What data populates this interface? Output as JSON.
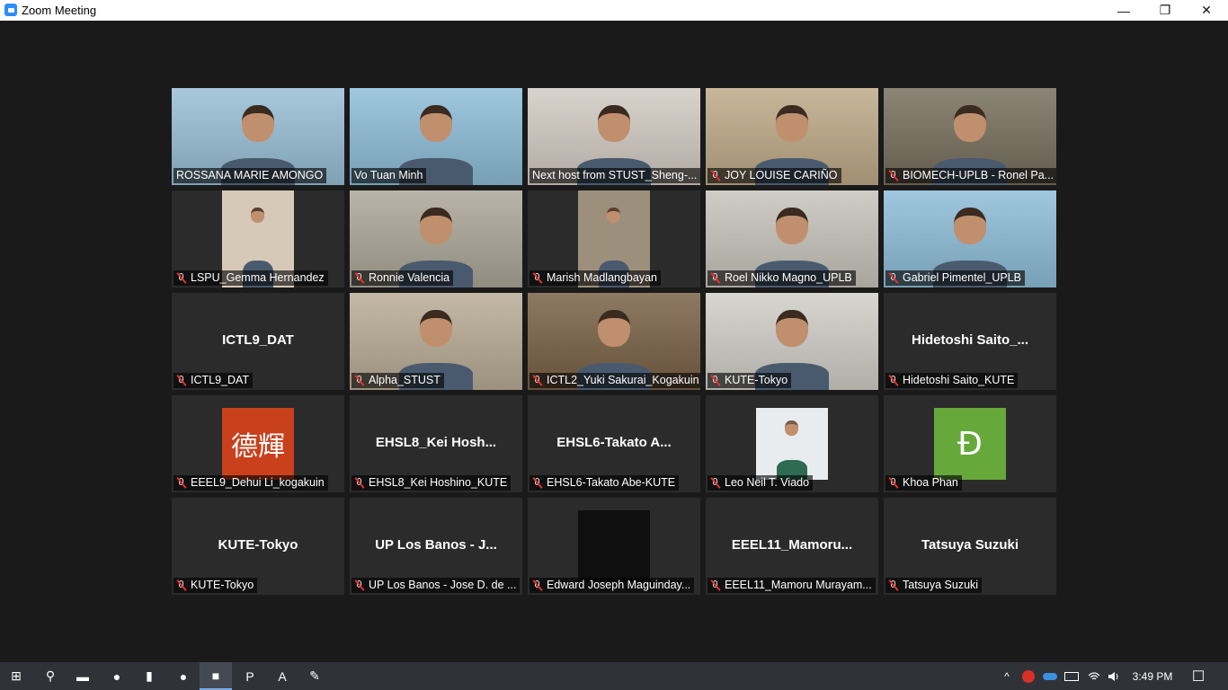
{
  "window": {
    "title": "Zoom Meeting",
    "minimize_glyph": "—",
    "restore_glyph": "❐",
    "close_glyph": "✕"
  },
  "participants": [
    {
      "label": "ROSSANA MARIE AMONGO",
      "video": true,
      "muted": false,
      "bg": "#a8c8dc"
    },
    {
      "label": "Vo Tuan Minh",
      "video": true,
      "muted": false,
      "active_speaker": true,
      "bg": "#9fc7de"
    },
    {
      "label": "Next host from STUST_Sheng-...",
      "video": true,
      "muted": false,
      "bg": "#d9d3cc"
    },
    {
      "label": "JOY LOUISE CARIÑO",
      "video": true,
      "muted": true,
      "bg": "#c9b79a"
    },
    {
      "label": "BIOMECH-UPLB - Ronel Pa...",
      "video": true,
      "muted": true,
      "bg": "#8c8576"
    },
    {
      "label": "LSPU_Gemma Hernandez",
      "video": true,
      "muted": true,
      "bg": "#d7c9b8",
      "inset": true
    },
    {
      "label": "Ronnie Valencia",
      "video": true,
      "muted": true,
      "bg": "#b9b4a8"
    },
    {
      "label": "Marish Madlangbayan",
      "video": true,
      "muted": true,
      "bg": "#9c8f7c",
      "inset": true
    },
    {
      "label": "Roel Nikko Magno_UPLB",
      "video": true,
      "muted": true,
      "bg": "#cfcdc5"
    },
    {
      "label": "Gabriel Pimentel_UPLB",
      "video": true,
      "muted": true,
      "bg": "#9fc7de"
    },
    {
      "label": "ICTL9_DAT",
      "video": false,
      "muted": true,
      "display_name": "ICTL9_DAT"
    },
    {
      "label": "Alpha_STUST",
      "video": true,
      "muted": true,
      "bg": "#c4b9a6"
    },
    {
      "label": "ICTL2_Yuki Sakurai_Kogakuin",
      "video": true,
      "muted": true,
      "bg": "#8e7a62"
    },
    {
      "label": "KUTE-Tokyo",
      "video": true,
      "muted": true,
      "bg": "#d8d6d0"
    },
    {
      "label": "Hidetoshi Saito_KUTE",
      "video": false,
      "muted": true,
      "display_name": "Hidetoshi  Saito_..."
    },
    {
      "label": "EEEL9_Dehui Li_kogakuin",
      "video": false,
      "muted": true,
      "avatar_text": "德輝",
      "avatar_bg": "#c9401c"
    },
    {
      "label": "EHSL8_Kei Hoshino_KUTE",
      "video": false,
      "muted": true,
      "display_name": "EHSL8_Kei  Hosh..."
    },
    {
      "label": "EHSL6-Takato Abe-KUTE",
      "video": false,
      "muted": true,
      "display_name": "EHSL6-Takato  A..."
    },
    {
      "label": "Leo Neil T. Viado",
      "video": false,
      "muted": true,
      "avatar_photo": true,
      "avatar_bg": "#e9ecef"
    },
    {
      "label": "Khoa Phan",
      "video": false,
      "muted": true,
      "avatar_text": "Đ",
      "avatar_bg": "#66a83a"
    },
    {
      "label": "KUTE-Tokyo",
      "video": false,
      "muted": true,
      "display_name": "KUTE-Tokyo"
    },
    {
      "label": "UP Los Banos - Jose D. de ...",
      "video": false,
      "muted": true,
      "display_name": "UP Los Banos - J..."
    },
    {
      "label": "Edward Joseph Maguinday...",
      "video": false,
      "muted": true,
      "avatar_dark": true,
      "avatar_bg": "#0f0f0f"
    },
    {
      "label": "EEEL11_Mamoru Murayam...",
      "video": false,
      "muted": true,
      "display_name": "EEEL11_Mamoru..."
    },
    {
      "label": "Tatsuya Suzuki",
      "video": false,
      "muted": true,
      "display_name": "Tatsuya Suzuki"
    }
  ],
  "taskbar": {
    "apps": [
      {
        "name": "start-icon",
        "glyph": "⊞"
      },
      {
        "name": "search-icon",
        "glyph": "⚲"
      },
      {
        "name": "file-explorer-icon",
        "glyph": "▬"
      },
      {
        "name": "chrome-icon",
        "glyph": "●"
      },
      {
        "name": "office-icon",
        "glyph": "▮"
      },
      {
        "name": "chrome-alt-icon",
        "glyph": "●"
      },
      {
        "name": "zoom-icon",
        "glyph": "■",
        "active": true
      },
      {
        "name": "powerpoint-icon",
        "glyph": "P"
      },
      {
        "name": "acrobat-icon",
        "glyph": "A"
      },
      {
        "name": "paint-icon",
        "glyph": "✎"
      }
    ],
    "clock": "3:49 PM",
    "tray_show_hidden_glyph": "^",
    "notification_glyph": "☐"
  }
}
